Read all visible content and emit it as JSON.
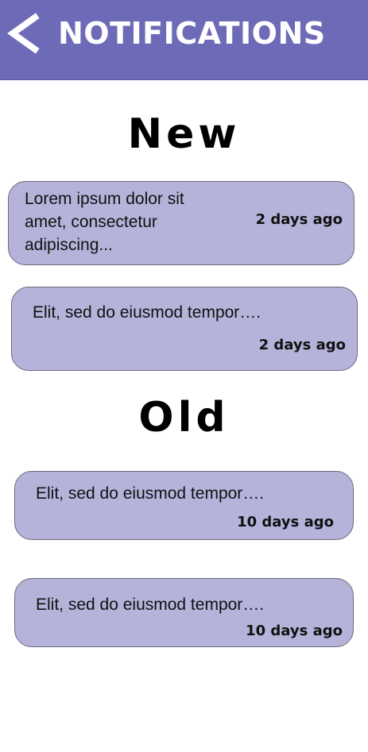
{
  "header": {
    "back_icon": "chevron-left-icon",
    "title": "NOTIFICATIONS",
    "background_color": "#6d6bb7"
  },
  "sections": {
    "new": {
      "title": "New",
      "items": [
        {
          "text_lines": [
            "Lorem ipsum dolor sit",
            "amet, consectetur",
            "adipiscing..."
          ],
          "time": "2 days ago"
        },
        {
          "text": "Elit, sed do eiusmod tempor….",
          "time": "2 days ago"
        }
      ]
    },
    "old": {
      "title": "Old",
      "items": [
        {
          "text": "Elit, sed do eiusmod tempor….",
          "time": "10 days ago"
        },
        {
          "text": "Elit, sed do eiusmod tempor….",
          "time": "10 days ago"
        }
      ]
    }
  },
  "colors": {
    "card_background": "#b5b3da",
    "card_border": "#6b6a7a"
  }
}
